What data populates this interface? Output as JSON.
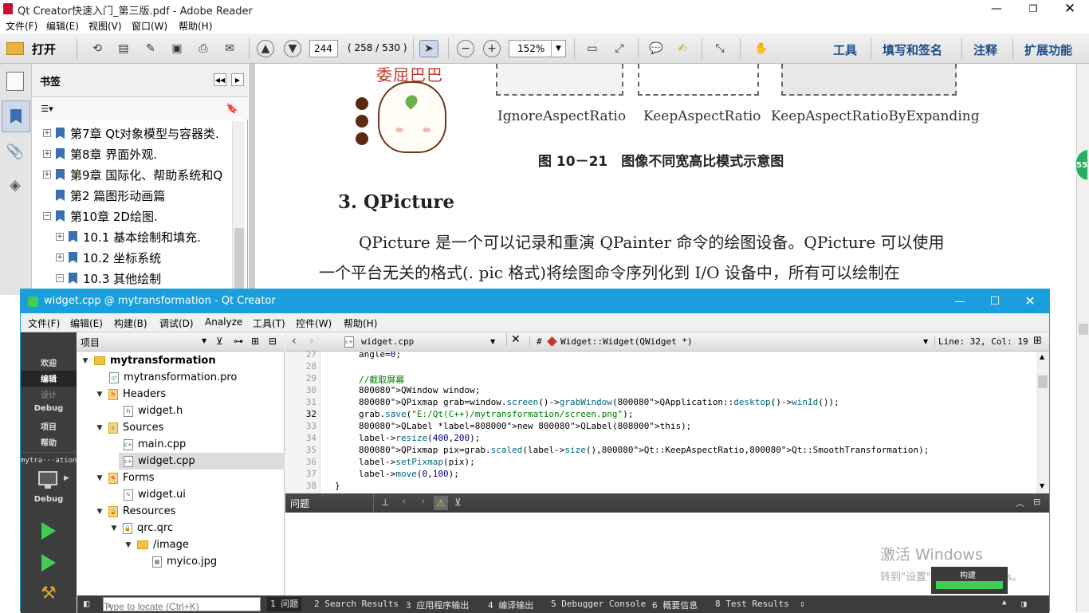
{
  "reader": {
    "title": "Qt Creator快速入门_第三版.pdf - Adobe Reader",
    "menu": [
      "文件(F)",
      "编辑(E)",
      "视图(V)",
      "窗口(W)",
      "帮助(H)"
    ],
    "open_label": "打开",
    "page_input": "244",
    "page_count": "( 258 / 530 )",
    "zoom": "152%",
    "right_links": [
      "工具",
      "填写和签名",
      "注释",
      "扩展功能"
    ],
    "bookmarks_title": "书签",
    "bookmarks": [
      {
        "label": "第7章 Qt对象模型与容器类."
      },
      {
        "label": "第8章 界面外观."
      },
      {
        "label": "第9章 国际化、帮助系统和Q"
      },
      {
        "label": "第2 篇图形动画篇"
      },
      {
        "label": "第10章 2D绘图."
      },
      {
        "label": "10.1 基本绘制和填充."
      },
      {
        "label": "10.2 坐标系统"
      },
      {
        "label": "10.3 其他绘制"
      }
    ],
    "doc": {
      "sticker_text": "委屈巴巴",
      "modes": [
        "IgnoreAspectRatio",
        "KeepAspectRatio",
        "KeepAspectRatioByExpanding"
      ],
      "figure_caption": "图 10－21　图像不同宽高比模式示意图",
      "heading": "3. QPicture",
      "para1": "QPicture 是一个可以记录和重演 QPainter 命令的绘图设备。QPicture 可以使用",
      "para2": "一个平台无关的格式(. pic 格式)将绘图命令序列化到 I/O 设备中，所有可以绘制在"
    },
    "badge": "55"
  },
  "qt": {
    "title": "widget.cpp @ mytransformation - Qt Creator",
    "menu": [
      "文件(F)",
      "编辑(E)",
      "构建(B)",
      "调试(D)",
      "Analyze",
      "工具(T)",
      "控件(W)",
      "帮助(H)"
    ],
    "modes": [
      "欢迎",
      "编辑",
      "设计",
      "Debug",
      "项目",
      "帮助"
    ],
    "kit_name": "mytra···ation",
    "kit_mode": "Debug",
    "project_header": "项目",
    "tree": [
      {
        "label": "mytransformation"
      },
      {
        "label": "mytransformation.pro"
      },
      {
        "label": "Headers"
      },
      {
        "label": "widget.h"
      },
      {
        "label": "Sources"
      },
      {
        "label": "main.cpp"
      },
      {
        "label": "widget.cpp"
      },
      {
        "label": "Forms"
      },
      {
        "label": "widget.ui"
      },
      {
        "label": "Resources"
      },
      {
        "label": "qrc.qrc"
      },
      {
        "label": "/image"
      },
      {
        "label": "myico.jpg"
      }
    ],
    "editor": {
      "file": "widget.cpp",
      "hash": "#",
      "symbol": "Widget::Widget(QWidget *)",
      "position": "Line: 32, Col: 19",
      "line_numbers": [
        "27",
        "28",
        "29",
        "30",
        "31",
        "32",
        "33",
        "34",
        "35",
        "36",
        "37",
        "38"
      ],
      "lines": [
        "angle=0;",
        "",
        "//截取屏幕",
        "QWindow window;",
        "QPixmap grab=window.screen()->grabWindow(QApplication::desktop()->winId());",
        "grab.save(\"E:/Qt(C++)/mytransformation/screen.png\");",
        "QLabel *label=new QLabel(this);",
        "label->resize(400,200);",
        "QPixmap pix=grab.scaled(label->size(),Qt::KeepAspectRatio,Qt::SmoothTransformation);",
        "label->setPixmap(pix);",
        "label->move(0,100);",
        "}"
      ]
    },
    "issues_title": "问题",
    "locate_placeholder": "Type to locate (Ctrl+K)",
    "status_tabs": [
      "1 问题",
      "2 Search Results",
      "3 应用程序输出",
      "4 编译输出",
      "5 Debugger Console",
      "6 概要信息",
      "8 Test Results"
    ],
    "watermark1": "激活 Windows",
    "watermark2": "转到\"设置\"以激活 Windows。",
    "build_label": "构建"
  },
  "colors": {
    "qt_title": "#1a9fdc",
    "link": "#1c4c8a",
    "keyword": "#808000",
    "type": "#800080",
    "string": "#008000",
    "comment": "#008000"
  }
}
